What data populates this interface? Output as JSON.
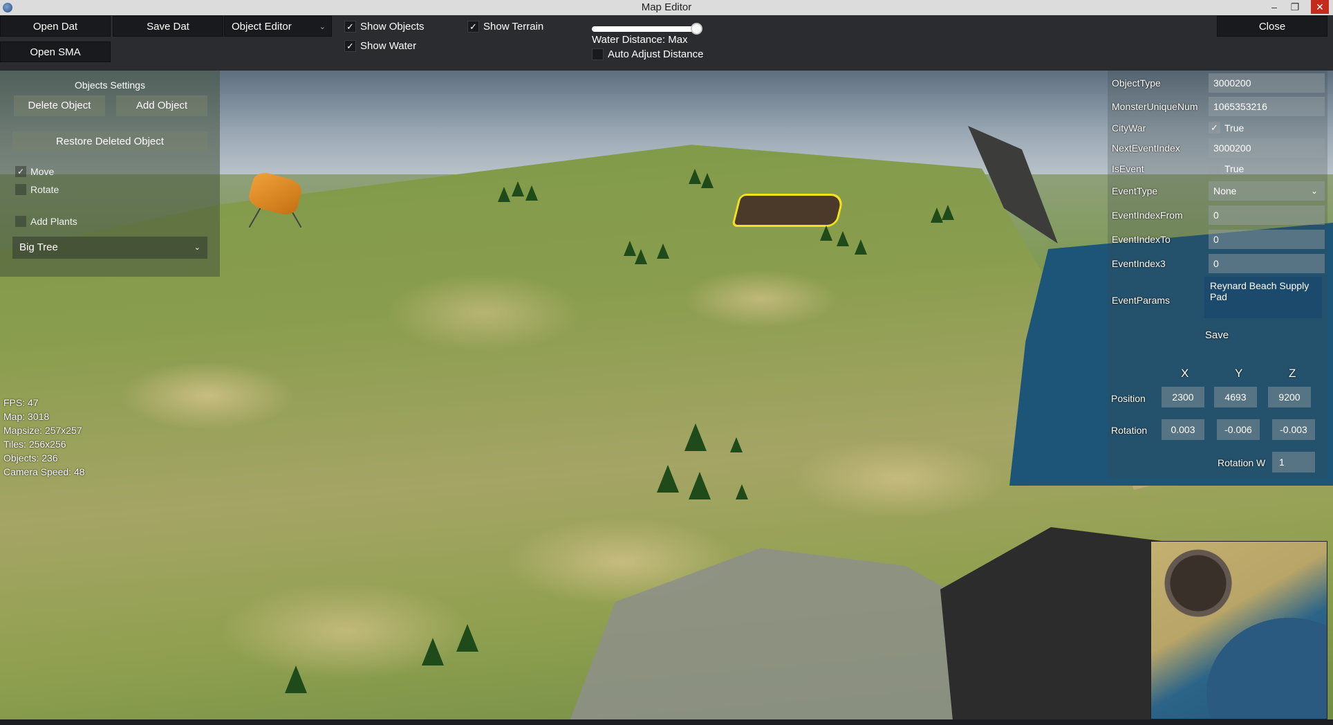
{
  "window": {
    "title": "Map Editor"
  },
  "toolbar": {
    "open_dat": "Open Dat",
    "save_dat": "Save Dat",
    "editor_mode": "Object Editor",
    "open_sma": "Open SMA",
    "close": "Close",
    "show_objects": {
      "label": "Show Objects",
      "checked": true
    },
    "show_water": {
      "label": "Show Water",
      "checked": true
    },
    "show_terrain": {
      "label": "Show Terrain",
      "checked": true
    },
    "water_distance_label": "Water Distance: Max",
    "water_distance_value": 1.0,
    "auto_adjust": {
      "label": "Auto Adjust Distance",
      "checked": false
    }
  },
  "objects_panel": {
    "title": "Objects Settings",
    "delete_object": "Delete Object",
    "add_object": "Add Object",
    "restore_deleted": "Restore Deleted Object",
    "move": {
      "label": "Move",
      "checked": true
    },
    "rotate": {
      "label": "Rotate",
      "checked": false
    },
    "add_plants": {
      "label": "Add Plants",
      "checked": false
    },
    "plant_type": "Big Tree"
  },
  "stats": {
    "fps": "FPS: 47",
    "map": "Map: 3018",
    "mapsize": "Mapsize: 257x257",
    "tiles": "Tiles: 256x256",
    "objects": "Objects: 236",
    "camera_speed": "Camera Speed: 48"
  },
  "properties": {
    "object_type": {
      "label": "ObjectType",
      "value": "3000200"
    },
    "monster_unique_num": {
      "label": "MonsterUniqueNum",
      "value": "1065353216"
    },
    "city_war": {
      "label": "CityWar",
      "value": "True",
      "checked": true
    },
    "next_event_index": {
      "label": "NextEventIndex",
      "value": "3000200"
    },
    "is_event": {
      "label": "IsEvent",
      "value": "True",
      "checked": false
    },
    "event_type": {
      "label": "EventType",
      "value": "None"
    },
    "event_index_from": {
      "label": "EventIndexFrom",
      "value": "0"
    },
    "event_index_to": {
      "label": "EventIndexTo",
      "value": "0"
    },
    "event_index3": {
      "label": "EventIndex3",
      "value": "0"
    },
    "event_params": {
      "label": "EventParams",
      "value": "Reynard Beach Supply Pad"
    },
    "save": "Save"
  },
  "transform": {
    "axes": [
      "X",
      "Y",
      "Z"
    ],
    "position": {
      "label": "Position",
      "x": "2300",
      "y": "4693",
      "z": "9200"
    },
    "rotation": {
      "label": "Rotation",
      "x": "0.003",
      "y": "-0.006",
      "z": "-0.003"
    },
    "rotation_w": {
      "label": "Rotation W",
      "value": "1"
    }
  },
  "icons": {
    "app": "app-icon",
    "minimize": "minimize-icon",
    "maximize": "maximize-icon",
    "close": "close-icon",
    "chevron": "chevron-down-icon",
    "check": "checkmark-icon"
  },
  "colors": {
    "selection_highlight": "#f3e219",
    "toolbar_bg": "#2a2c30",
    "button_bg": "#181a1d",
    "window_close": "#c42b1c"
  }
}
